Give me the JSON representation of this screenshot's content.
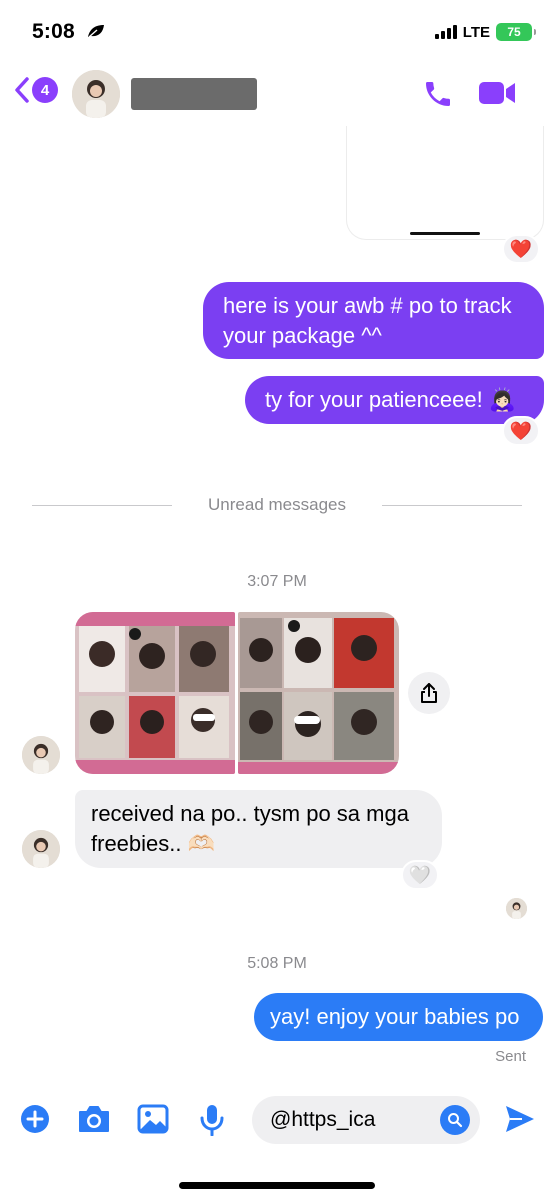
{
  "status_bar": {
    "time": "5:08",
    "network": "LTE",
    "battery": "75"
  },
  "header": {
    "back_count": "4"
  },
  "messages": {
    "outgoing_1": "here is your awb # po to track your package ^^",
    "outgoing_2": "ty for your patienceee! 🙇🏻‍♀️",
    "reaction_heart": "❤️",
    "reaction_white_heart": "🤍",
    "unread_divider": "Unread messages",
    "timestamp_1": "3:07 PM",
    "incoming_1": "received na po.. tysm po sa mga freebies.. 🫶🏻",
    "timestamp_2": "5:08 PM",
    "outgoing_3": "yay! enjoy your babies po",
    "sent_label": "Sent"
  },
  "composer": {
    "input_value": "@https_ica"
  },
  "colors": {
    "accent_purple": "#8a3ffc",
    "bubble_purple": "#7b3ff2",
    "bubble_blue": "#2b7cf6",
    "incoming_gray": "#efeff1",
    "battery_green": "#34c759"
  },
  "icons": {
    "back": "chevron-left-icon",
    "call": "phone-icon",
    "video": "video-camera-icon",
    "share": "share-icon",
    "add": "plus-circle-icon",
    "camera": "camera-icon",
    "gallery": "image-icon",
    "mic": "microphone-icon",
    "search": "search-icon",
    "send": "send-icon"
  }
}
